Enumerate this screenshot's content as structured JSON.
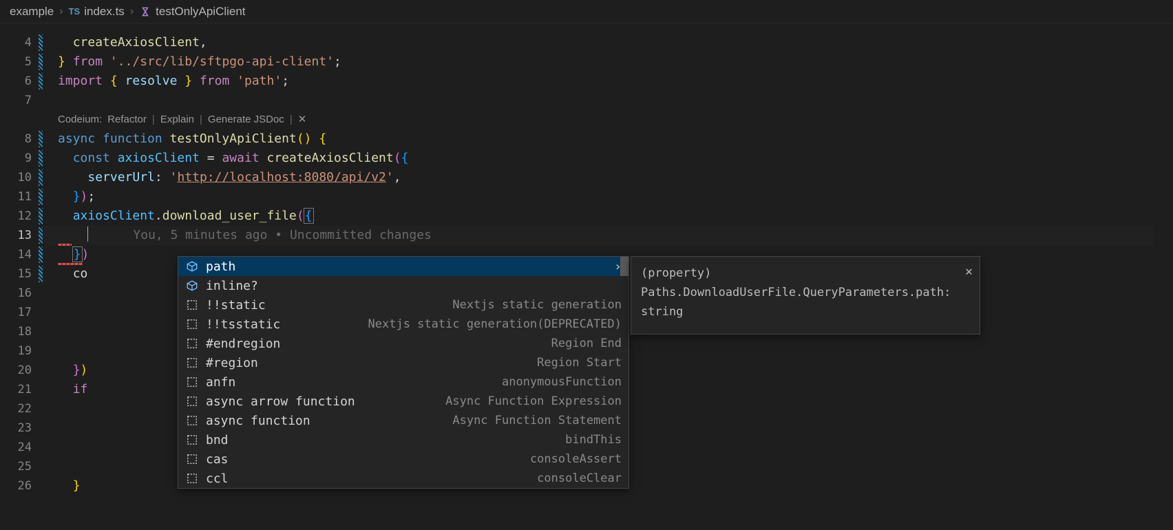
{
  "breadcrumb": {
    "folder": "example",
    "file_icon": "TS",
    "file": "index.ts",
    "symbol": "testOnlyApiClient"
  },
  "line_numbers": [
    "4",
    "5",
    "6",
    "7",
    "8",
    "9",
    "10",
    "11",
    "12",
    "13",
    "14",
    "15",
    "16",
    "17",
    "18",
    "19",
    "20",
    "21",
    "22",
    "23",
    "24",
    "25",
    "26"
  ],
  "current_line_index": 9,
  "modified_line_indexes": [
    0,
    1,
    2,
    4,
    5,
    6,
    7,
    8,
    9,
    10,
    11
  ],
  "codelens": {
    "prefix": "Codeium:",
    "actions": [
      "Refactor",
      "Explain",
      "Generate JSDoc"
    ]
  },
  "code": {
    "l4": {
      "fn": "createAxiosClient"
    },
    "l5": {
      "path": "'../src/lib/sftpgo-api-client'"
    },
    "l6": {
      "resolve": "resolve",
      "mod": "'path'"
    },
    "l8": {
      "name": "testOnlyApiClient"
    },
    "l9": {
      "v": "axiosClient",
      "fn": "createAxiosClient"
    },
    "l10": {
      "key": "serverUrl",
      "url": "http://localhost:8080/api/v2"
    },
    "l12": {
      "obj": "axiosClient",
      "method": "download_user_file"
    },
    "l13_blame": "You, 5 minutes ago • Uncommitted changes",
    "l15": "co",
    "l21": "if"
  },
  "suggest": {
    "items": [
      {
        "icon": "field",
        "label": "path",
        "hint": "",
        "selected": true,
        "has_chev": true
      },
      {
        "icon": "field",
        "label": "inline?",
        "hint": ""
      },
      {
        "icon": "snippet",
        "label": "!!static",
        "hint": "Nextjs static generation"
      },
      {
        "icon": "snippet",
        "label": "!!tsstatic",
        "hint": "Nextjs static generation(DEPRECATED)"
      },
      {
        "icon": "snippet",
        "label": "#endregion",
        "hint": "Region End"
      },
      {
        "icon": "snippet",
        "label": "#region",
        "hint": "Region Start"
      },
      {
        "icon": "snippet",
        "label": "anfn",
        "hint": "anonymousFunction"
      },
      {
        "icon": "snippet",
        "label": "async arrow function",
        "hint": "Async Function Expression"
      },
      {
        "icon": "snippet",
        "label": "async function",
        "hint": "Async Function Statement"
      },
      {
        "icon": "snippet",
        "label": "bnd",
        "hint": "bindThis"
      },
      {
        "icon": "snippet",
        "label": "cas",
        "hint": "consoleAssert"
      },
      {
        "icon": "snippet",
        "label": "ccl",
        "hint": "consoleClear"
      }
    ]
  },
  "details": {
    "text": "(property) Paths.DownloadUserFile.QueryParameters.path: string"
  }
}
